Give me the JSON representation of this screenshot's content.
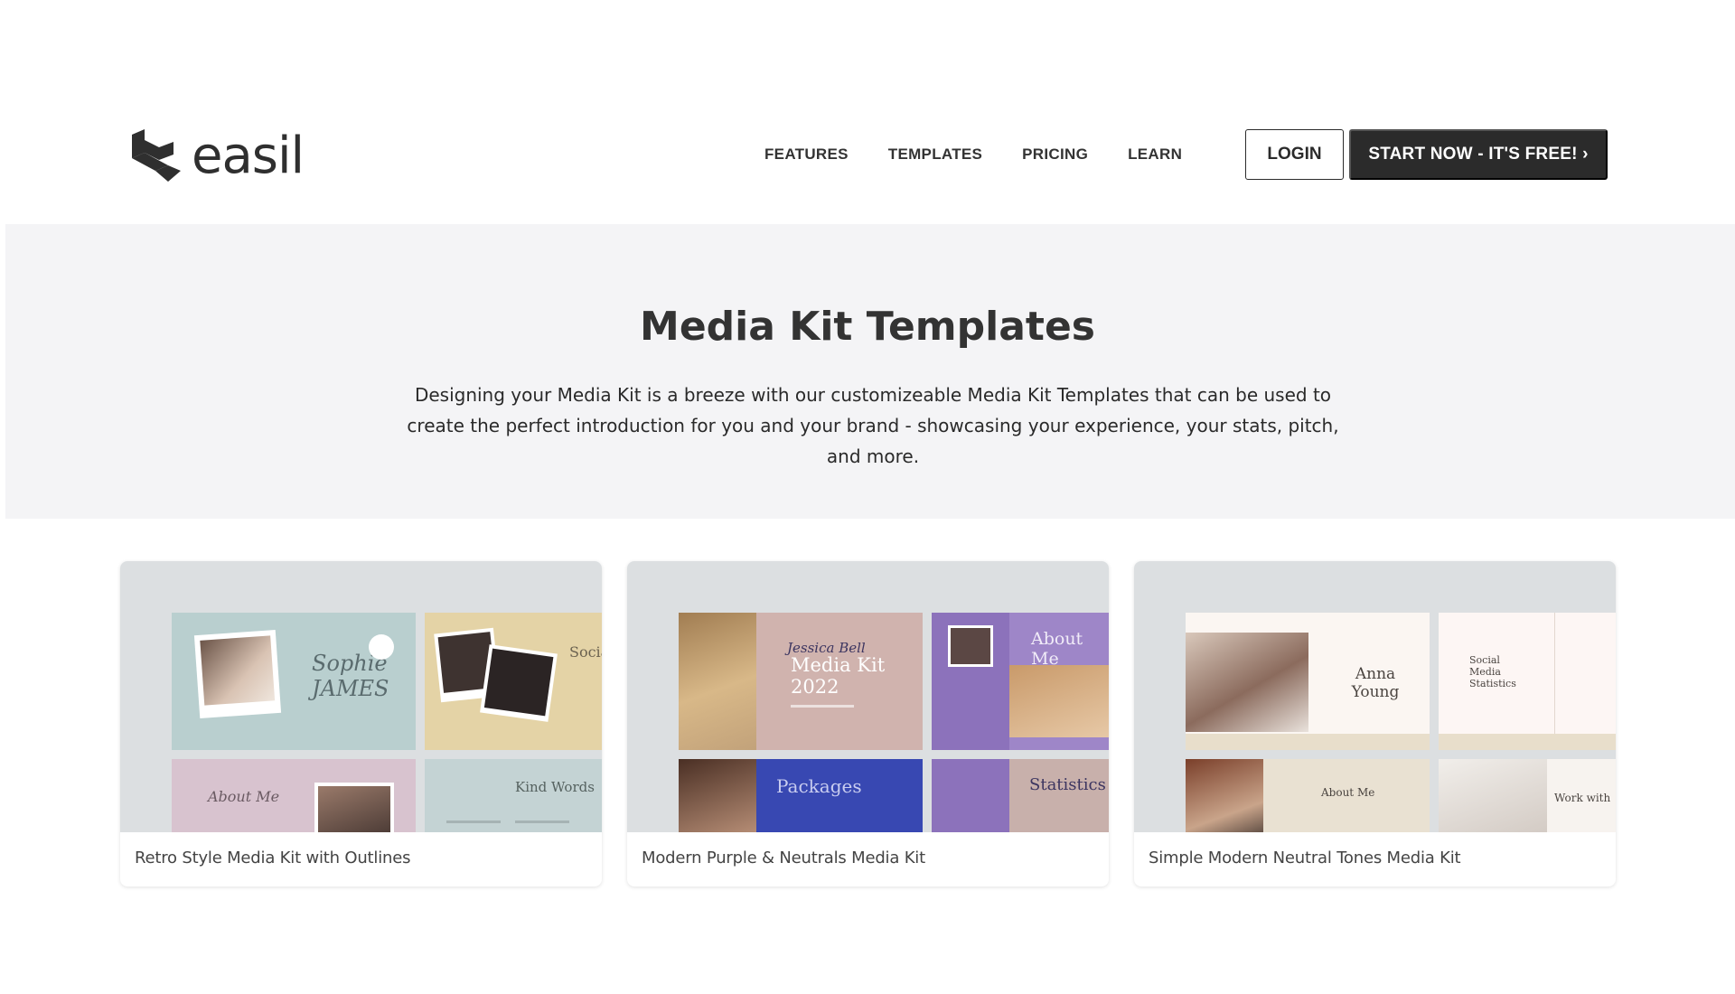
{
  "header": {
    "logo_text": "easil",
    "nav": [
      {
        "label": "FEATURES"
      },
      {
        "label": "TEMPLATES"
      },
      {
        "label": "PRICING"
      },
      {
        "label": "LEARN"
      }
    ],
    "login_label": "LOGIN",
    "start_label": "START NOW - IT'S FREE! ›"
  },
  "hero": {
    "title": "Media Kit Templates",
    "description": "Designing your Media Kit is a breeze with our customizeable Media Kit Templates that can be used to create the perfect introduction for you and your brand - showcasing your experience, your stats, pitch, and more."
  },
  "cards": [
    {
      "label": "Retro Style Media Kit with Outlines",
      "slides": {
        "name": "Sophie JAMES",
        "social": "Social",
        "about": "About Me",
        "kind": "Kind Words"
      }
    },
    {
      "label": "Modern Purple & Neutrals Media Kit",
      "slides": {
        "script": "Jessica Bell",
        "title": "Media Kit",
        "year": "2022",
        "about": "About Me",
        "packages": "Packages",
        "stats": "Statistics"
      }
    },
    {
      "label": "Simple Modern Neutral Tones Media Kit",
      "slides": {
        "name": "Anna Young",
        "social": "Social Media Statistics",
        "about": "About Me",
        "work": "Work with"
      }
    }
  ],
  "colors": {
    "brand_dark": "#2b2b2b",
    "hero_bg": "#f4f4f6",
    "thumb_bg": "#dcdfe1"
  }
}
